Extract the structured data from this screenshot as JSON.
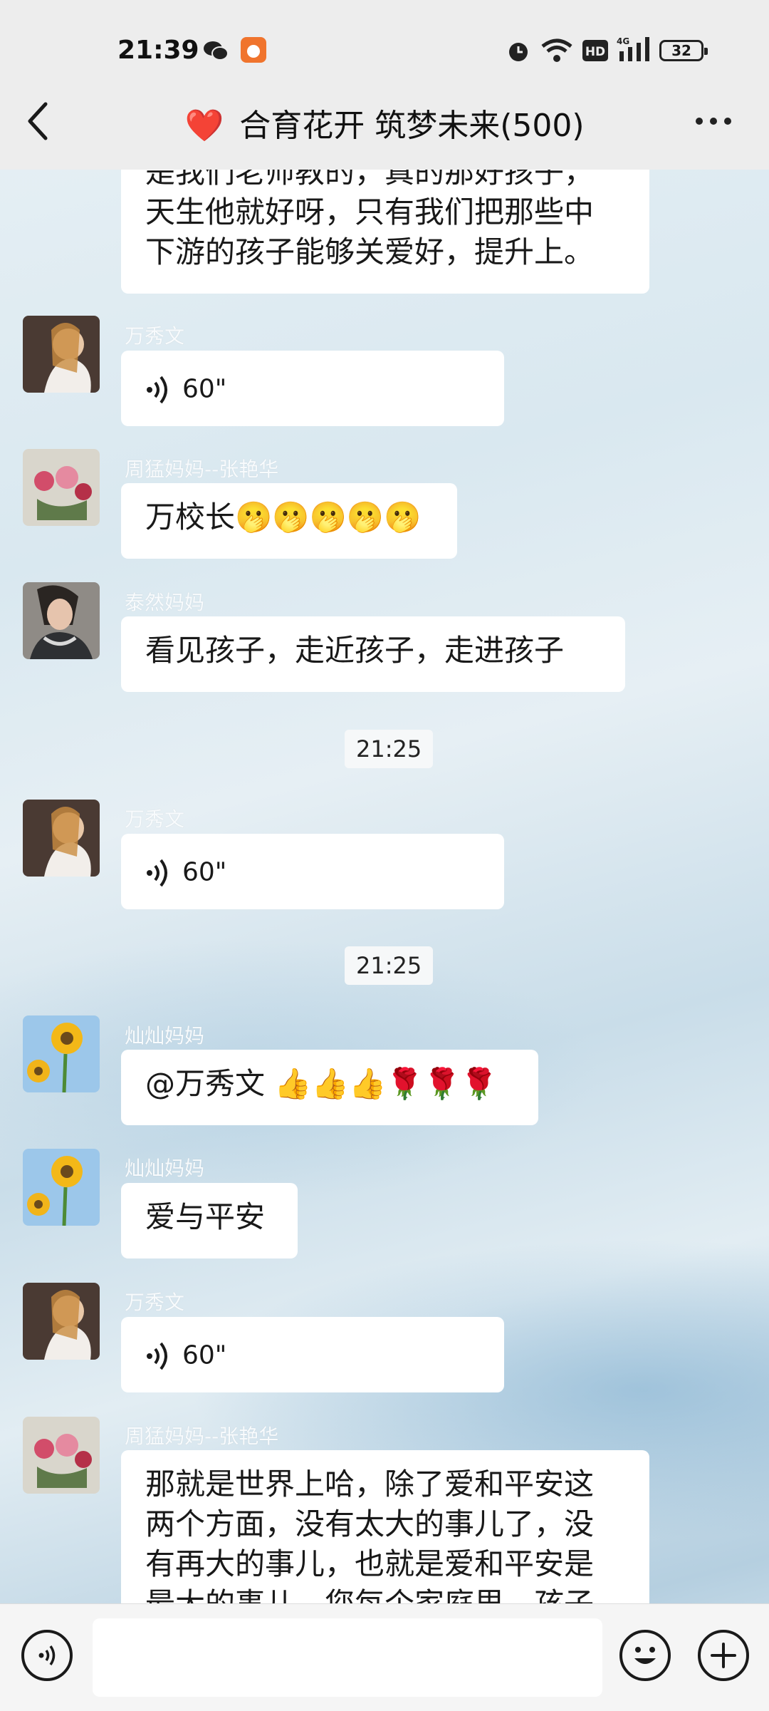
{
  "status_bar": {
    "time": "21:39",
    "battery": "32"
  },
  "header": {
    "heart": "❤️",
    "title": "合育花开 筑梦未来(500)"
  },
  "messages": {
    "m0": {
      "text_lines": [
        "是我们老师教的，真的那好孩子，",
        "天生他就好呀，只有我们把那些中",
        "下游的孩子能够关爱好，提升上。"
      ]
    },
    "m1": {
      "sender": "万秀文",
      "duration": "60\""
    },
    "m2": {
      "sender": "周猛妈妈--张艳华",
      "text": "万校长🫢🫢🫢🫢🫢"
    },
    "m3": {
      "sender": "泰然妈妈",
      "text": "看见孩子，走近孩子，走进孩子"
    },
    "t1": "21:25",
    "m4": {
      "sender": "万秀文",
      "duration": "60\""
    },
    "t2": "21:25",
    "m5": {
      "sender": "灿灿妈妈",
      "text": "@万秀文 👍👍👍🌹🌹🌹"
    },
    "m6": {
      "sender": "灿灿妈妈",
      "text": "爱与平安"
    },
    "m7": {
      "sender": "万秀文",
      "duration": "60\""
    },
    "m8": {
      "sender": "周猛妈妈--张艳华",
      "text_lines": [
        "那就是世界上哈，除了爱和平安这",
        "两个方面，没有太大的事儿了，没",
        "有再大的事儿，也就是爱和平安是",
        "最大的事儿，您每个家庭里，孩子"
      ]
    }
  },
  "colors": {
    "accent_heart": "#e0262a",
    "bubble": "#ffffff",
    "topbar": "#ededed"
  },
  "icons": [
    "back-icon",
    "more-icon",
    "voice-icon",
    "emoji-icon",
    "plus-icon",
    "wechat-icon",
    "app-icon",
    "alarm-icon",
    "wifi-icon",
    "hd-icon",
    "signal-icon"
  ]
}
